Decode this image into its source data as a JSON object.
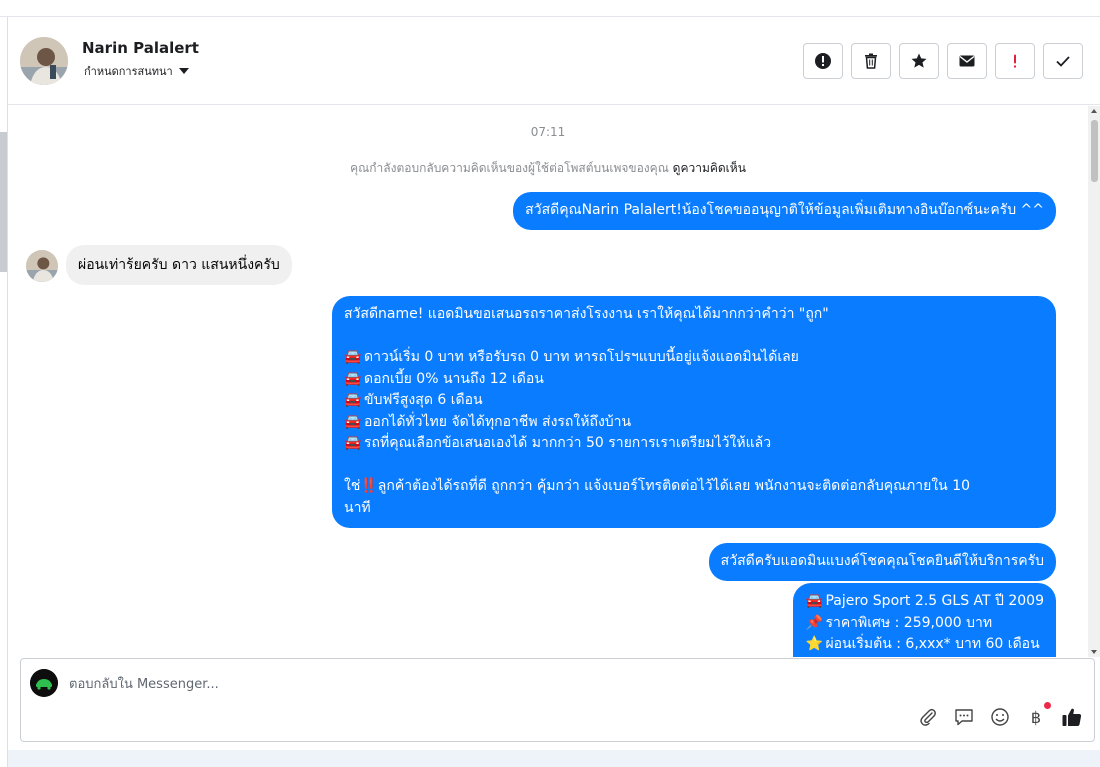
{
  "header": {
    "name": "Narin Palalert",
    "subtitle": "กำหนดการสนทนา"
  },
  "colors": {
    "outgoing_bubble": "#0a7cff",
    "incoming_bubble": "#f0f0f0",
    "notification_dot": "#f02849"
  },
  "actions": [
    {
      "icon": "alert-circle-icon"
    },
    {
      "icon": "trash-icon"
    },
    {
      "icon": "star-icon"
    },
    {
      "icon": "envelope-icon"
    },
    {
      "icon": "exclamation-icon"
    },
    {
      "icon": "check-icon"
    }
  ],
  "thread": {
    "timestamp": "07:11",
    "notice_text": "คุณกำลังตอบกลับความคิดเห็นของผู้ใช้ต่อโพสต์บนเพจของคุณ ",
    "notice_link": "ดูความคิดเห็น",
    "messages": {
      "m1": "สวัสดีคุณNarin Palalert!น้องโชคขออนุญาติให้ข้อมูลเพิ่มเติมทางอินบ๊อกซ์นะครับ ^^",
      "m2": "ผ่อนเท่าร้ยครับ ดาว แสนหนึ่งครับ",
      "m3": {
        "intro": "สวัสดีname! แอดมินขอเสนอรถราคาส่งโรงงาน เราให้คุณได้มากกว่าคำว่า \"ถูก\"",
        "bullet_emoji": "🚘",
        "bullets": [
          "ดาวน์เริ่ม 0 บาท หรือรับรถ 0 บาท หารถโปรฯแบบนี้อยู่แจ้งแอดมินได้เลย",
          "ดอกเบี้ย 0% นานถึง 12 เดือน",
          "ขับฟรีสูงสุด 6 เดือน",
          "ออกได้ทั่วไทย จัดได้ทุกอาชีพ ส่งรถให้ถึงบ้าน",
          "รถที่คุณเลือกข้อเสนอเองได้ มากกว่า 50 รายการเราเตรียมไว้ให้แล้ว"
        ],
        "outro_prefix": "ใช่",
        "outro_emoji": "‼️",
        "outro_line1": "ลูกค้าต้องได้รถที่ดี ถูกกว่า คุ้มกว่า แจ้งเบอร์โทรติดต่อไว้ได้เลย พนักงานจะติดต่อกลับคุณภายใน 10",
        "outro_line2": "นาที"
      },
      "m4": "สวัสดีครับแอดมินแบงค์โชคคุณโชคยินดีให้บริการครับ",
      "m5": {
        "line1_emoji": "🚘",
        "line1": "Pajero Sport 2.5 GLS AT ปี 2009",
        "line2_emoji": "📌",
        "line2": "ราคาพิเศษ : 259,000 บาท",
        "line3_emoji": "⭐",
        "line3": "ผ่อนเริ่มต้น : 6,xxx* บาท 60 เดือน"
      }
    }
  },
  "composer": {
    "placeholder": "ตอบกลับใน Messenger...",
    "currency_symbol": "฿",
    "icons": [
      "paperclip-icon",
      "chat-bubble-icon",
      "smiley-icon",
      "baht-icon",
      "thumbs-up-icon"
    ]
  }
}
